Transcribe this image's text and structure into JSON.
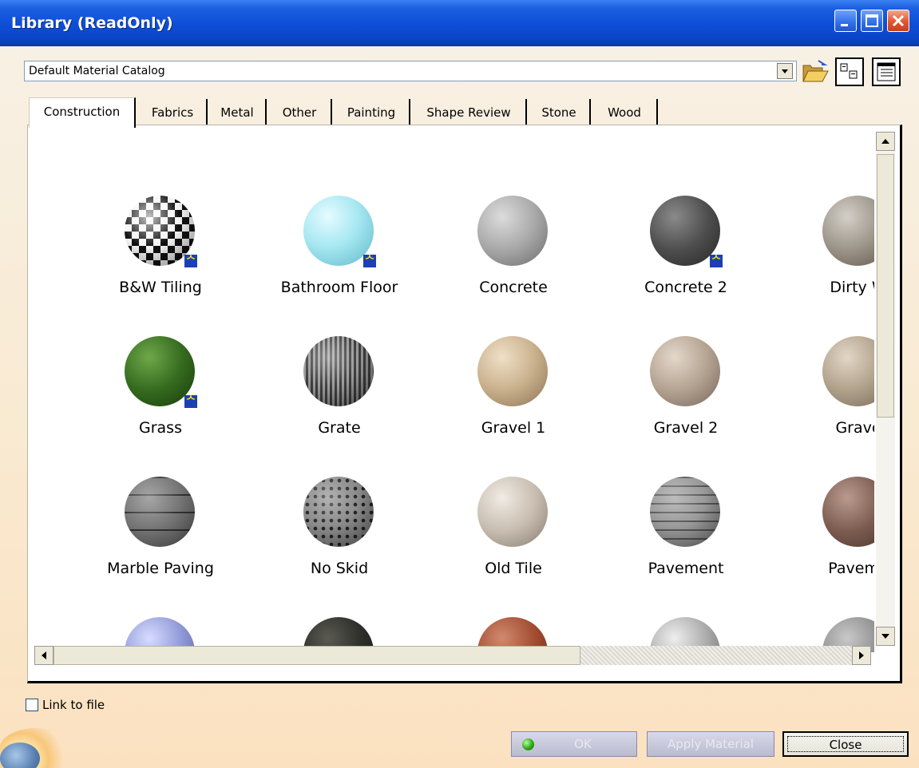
{
  "window": {
    "title": "Library (ReadOnly)",
    "controls": [
      "minimize",
      "maximize",
      "close"
    ]
  },
  "catalog": {
    "selected": "Default Material Catalog"
  },
  "toolbar": {
    "icons": [
      "folder-open-icon",
      "large-icons-view-icon",
      "details-view-icon"
    ]
  },
  "tabs": [
    {
      "label": "Construction",
      "active": true
    },
    {
      "label": "Fabrics",
      "active": false
    },
    {
      "label": "Metal",
      "active": false
    },
    {
      "label": "Other",
      "active": false
    },
    {
      "label": "Painting",
      "active": false
    },
    {
      "label": "Shape Review",
      "active": false
    },
    {
      "label": "Stone",
      "active": false
    },
    {
      "label": "Wood",
      "active": false
    }
  ],
  "materials": [
    {
      "label": "B&W Tiling",
      "badge": true
    },
    {
      "label": "Bathroom Floor",
      "badge": true
    },
    {
      "label": "Concrete",
      "badge": false
    },
    {
      "label": "Concrete 2",
      "badge": true
    },
    {
      "label": "Dirty W",
      "badge": false
    },
    {
      "label": "Grass",
      "badge": true
    },
    {
      "label": "Grate",
      "badge": false
    },
    {
      "label": "Gravel 1",
      "badge": false
    },
    {
      "label": "Gravel 2",
      "badge": false
    },
    {
      "label": "Grave",
      "badge": false
    },
    {
      "label": "Marble Paving",
      "badge": false
    },
    {
      "label": "No Skid",
      "badge": false
    },
    {
      "label": "Old Tile",
      "badge": false
    },
    {
      "label": "Pavement",
      "badge": false
    },
    {
      "label": "Paveme",
      "badge": false
    }
  ],
  "link_to_file": {
    "label": "Link to file",
    "checked": false
  },
  "buttons": {
    "ok": "OK",
    "apply": "Apply Material",
    "close": "Close"
  },
  "colors": {
    "title_bar": "#0f4fd8",
    "dialog_bg": "#fbe8cd",
    "link_badge": "#1d3fb5"
  }
}
